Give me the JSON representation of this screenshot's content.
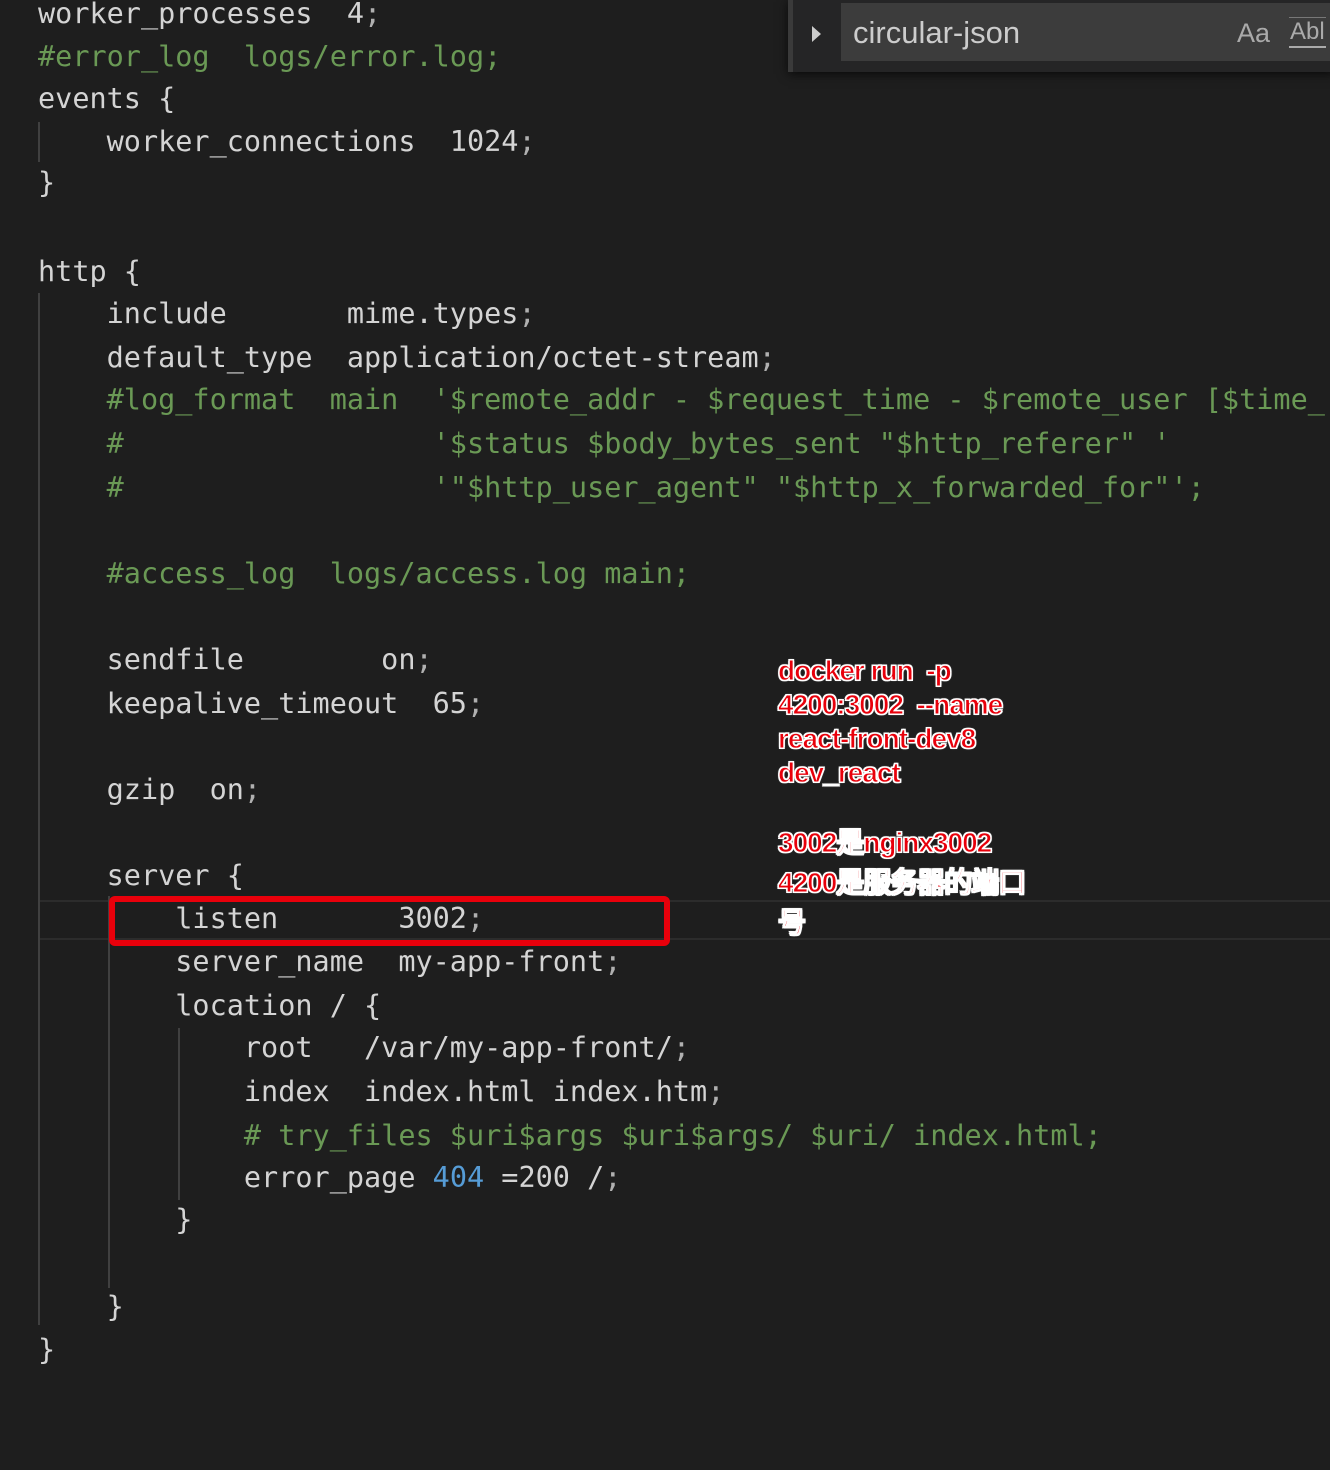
{
  "editor": {
    "lines": [
      [
        {
          "t": "worker_processes  4",
          "c": "text"
        },
        {
          "t": ";",
          "c": "punct"
        }
      ],
      [
        {
          "t": "#error_log  logs/error.log;",
          "c": "comment"
        }
      ],
      [
        {
          "t": "events {",
          "c": "text"
        }
      ],
      [
        {
          "t": "    worker_connections  1024",
          "c": "text"
        },
        {
          "t": ";",
          "c": "punct"
        }
      ],
      [
        {
          "t": "}",
          "c": "text"
        }
      ],
      [
        {
          "t": "http {",
          "c": "text"
        }
      ],
      [
        {
          "t": "    include       mime.types",
          "c": "text"
        },
        {
          "t": ";",
          "c": "punct"
        }
      ],
      [
        {
          "t": "    default_type  application/octet-stream",
          "c": "text"
        },
        {
          "t": ";",
          "c": "punct"
        }
      ],
      [
        {
          "t": "    #log_format  main  '$remote_addr - $request_time - $remote_user [$time_",
          "c": "comment"
        }
      ],
      [
        {
          "t": "    #                  '$status $body_bytes_sent \"$http_referer\" '",
          "c": "comment"
        }
      ],
      [
        {
          "t": "    #                  '\"$http_user_agent\" \"$http_x_forwarded_for\"';",
          "c": "comment"
        }
      ],
      [
        {
          "t": "    #access_log  logs/access.log main;",
          "c": "comment"
        }
      ],
      [
        {
          "t": "    sendfile        on",
          "c": "text"
        },
        {
          "t": ";",
          "c": "punct"
        }
      ],
      [
        {
          "t": "    keepalive_timeout  65",
          "c": "text"
        },
        {
          "t": ";",
          "c": "punct"
        }
      ],
      [
        {
          "t": "    gzip  on",
          "c": "text"
        },
        {
          "t": ";",
          "c": "punct"
        }
      ],
      [
        {
          "t": "    server {",
          "c": "text"
        }
      ],
      [
        {
          "t": "        listen       3002",
          "c": "text"
        },
        {
          "t": ";",
          "c": "punct"
        }
      ],
      [
        {
          "t": "        server_name  my-app-front",
          "c": "text"
        },
        {
          "t": ";",
          "c": "punct"
        }
      ],
      [
        {
          "t": "        location / {",
          "c": "text"
        }
      ],
      [
        {
          "t": "            root   /var/my-app-front/",
          "c": "text"
        },
        {
          "t": ";",
          "c": "punct"
        }
      ],
      [
        {
          "t": "            index  index.html index.htm",
          "c": "text"
        },
        {
          "t": ";",
          "c": "punct"
        }
      ],
      [
        {
          "t": "            # try_files $uri$args $uri$args/ $uri/ index.html;",
          "c": "comment"
        }
      ],
      [
        {
          "t": "            error_page ",
          "c": "text"
        },
        {
          "t": "404",
          "c": "number"
        },
        {
          "t": " =200 /",
          "c": "text"
        },
        {
          "t": ";",
          "c": "punct"
        }
      ],
      [
        {
          "t": "        }",
          "c": "text"
        }
      ],
      [
        {
          "t": "    }",
          "c": "text"
        }
      ],
      [
        {
          "t": "}",
          "c": "text"
        }
      ]
    ]
  },
  "find_widget": {
    "toggle_icon": "chevron-right-icon",
    "search_value": "circular-json",
    "match_case_label": "Aa",
    "whole_word_label": "Abl"
  },
  "annotation": {
    "docker_command_lines": [
      "docker run  -p",
      "4200:3002  --name",
      "react-front-dev8",
      "dev_react"
    ],
    "port_note_lines": [
      "3002是nginx3002",
      "4200是服务器的端口",
      "号"
    ],
    "color": "#e8000b"
  }
}
